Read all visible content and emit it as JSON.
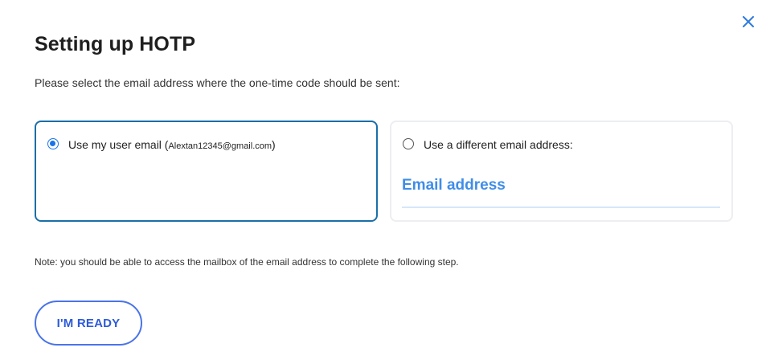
{
  "dialog": {
    "title": "Setting up HOTP",
    "instruction": "Please select the email address where the one-time code should be sent:",
    "close_icon": "close-icon",
    "accent_color": "#1a73e8"
  },
  "options": {
    "user_email": {
      "label": "Use my user email (",
      "email": "Alextan12345@gmail.com",
      "suffix": ")",
      "selected": true
    },
    "different_email": {
      "label": "Use a different email address:",
      "selected": false,
      "input": {
        "placeholder": "Email address",
        "value": ""
      }
    }
  },
  "note": "Note: you should be able to access the mailbox of the email address to complete the following step.",
  "actions": {
    "ready_label": "I'M READY"
  }
}
